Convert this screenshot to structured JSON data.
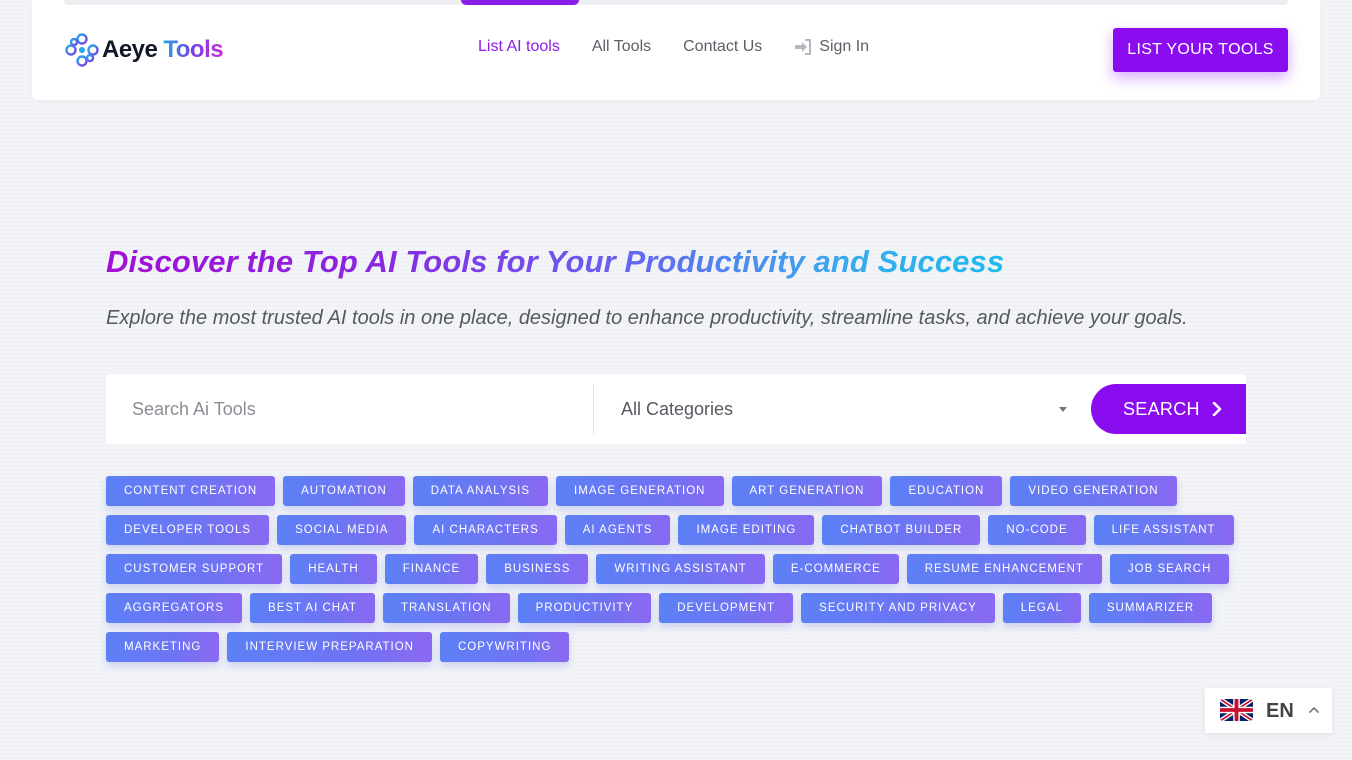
{
  "brand": {
    "name_part1": "Aeye",
    "name_part2": "Tools"
  },
  "nav": {
    "items": [
      {
        "label": "List AI tools",
        "active": true
      },
      {
        "label": "All Tools",
        "active": false
      },
      {
        "label": "Contact Us",
        "active": false
      }
    ],
    "signin_label": "Sign In"
  },
  "header": {
    "cta_label": "LIST YOUR TOOLS"
  },
  "hero": {
    "title": "Discover the Top AI Tools for Your Productivity and Success",
    "subtitle": "Explore the most trusted AI tools in one place, designed to enhance productivity, streamline tasks, and achieve your goals."
  },
  "search": {
    "placeholder": "Search Ai Tools",
    "category_selected": "All Categories",
    "button_label": "SEARCH"
  },
  "tags": [
    [
      "CONTENT CREATION",
      "AUTOMATION",
      "DATA ANALYSIS",
      "IMAGE GENERATION",
      "ART GENERATION",
      "EDUCATION",
      "VIDEO GENERATION"
    ],
    [
      "DEVELOPER TOOLS",
      "SOCIAL MEDIA",
      "AI CHARACTERS",
      "AI AGENTS",
      "IMAGE EDITING",
      "CHATBOT BUILDER",
      "NO-CODE",
      "LIFE ASSISTANT"
    ],
    [
      "CUSTOMER SUPPORT",
      "HEALTH",
      "FINANCE",
      "BUSINESS",
      "WRITING ASSISTANT",
      "E-COMMERCE",
      "RESUME ENHANCEMENT",
      "JOB SEARCH"
    ],
    [
      "AGGREGATORS",
      "BEST AI CHAT",
      "TRANSLATION",
      "PRODUCTIVITY",
      "DEVELOPMENT",
      "SECURITY AND PRIVACY",
      "LEGAL",
      "SUMMARIZER"
    ],
    [
      "MARKETING",
      "INTERVIEW PREPARATION",
      "COPYWRITING"
    ]
  ],
  "language": {
    "code": "EN",
    "flag_icon": "uk-flag-icon"
  },
  "colors": {
    "accent": "#8a0df0",
    "tag_start": "#5c80f6",
    "tag_end": "#8a68f2"
  }
}
